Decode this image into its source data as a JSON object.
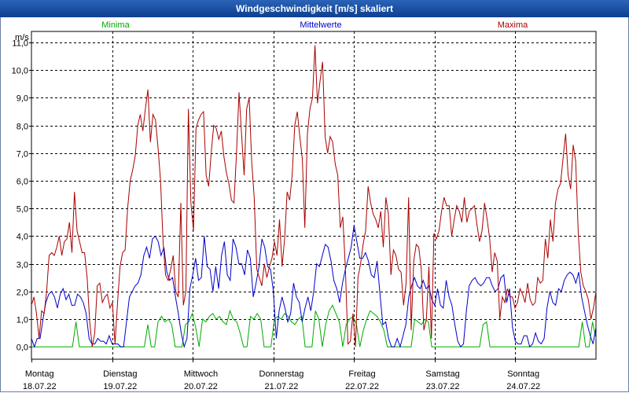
{
  "window": {
    "title": "Windgeschwindigkeit [m/s] skaliert"
  },
  "chart_data": {
    "type": "line",
    "title": "Windgeschwindigkeit [m/s] skaliert",
    "ylabel": "m/s",
    "ylim": [
      -0.45,
      11.4
    ],
    "yticks": [
      "0,0",
      "1,0",
      "2,0",
      "3,0",
      "4,0",
      "5,0",
      "6,0",
      "7,0",
      "8,0",
      "9,0",
      "10,0",
      "11,0"
    ],
    "grid": true,
    "legend_placement": "top",
    "days": [
      {
        "weekday": "Montag",
        "date": "18.07.22"
      },
      {
        "weekday": "Dienstag",
        "date": "19.07.22"
      },
      {
        "weekday": "Mittwoch",
        "date": "20.07.22"
      },
      {
        "weekday": "Donnerstag",
        "date": "21.07.22"
      },
      {
        "weekday": "Freitag",
        "date": "22.07.22"
      },
      {
        "weekday": "Samstag",
        "date": "23.07.22"
      },
      {
        "weekday": "Sonntag",
        "date": "24.07.22"
      }
    ],
    "x_range_days": [
      0,
      7
    ],
    "series": [
      {
        "name": "Minima",
        "color": "#00aa00",
        "values": [
          0,
          0,
          0,
          0,
          0,
          0,
          0,
          0,
          0,
          0,
          0,
          0,
          0,
          0.9,
          0,
          0,
          0,
          0,
          0,
          0,
          0,
          0,
          0,
          0,
          0,
          0,
          0,
          0,
          0,
          0,
          0,
          0,
          0,
          0,
          0.8,
          0,
          0,
          0.9,
          1.1,
          0.9,
          1.0,
          0.8,
          0,
          0,
          0,
          0.8,
          0.9,
          1.2,
          0.7,
          0,
          1.0,
          0.9,
          1.1,
          1.2,
          1.0,
          1.1,
          0.9,
          0.8,
          1.3,
          1.0,
          0.9,
          0.5,
          0,
          0,
          1.1,
          1.0,
          1.2,
          1.0,
          0,
          0,
          0,
          1.0,
          1.1,
          1.0,
          1.2,
          1.1,
          0.9,
          0.8,
          1.0,
          1.1,
          0,
          0,
          0,
          1.3,
          1.0,
          0,
          0.8,
          1.3,
          1.5,
          1.2,
          0.9,
          0,
          0.8,
          1.0,
          1.1,
          0.8,
          0,
          0.6,
          1.0,
          1.3,
          1.2,
          1.1,
          0.9,
          0.6,
          0,
          0,
          0,
          0,
          0,
          0,
          0,
          0,
          1.0,
          0.9,
          0.8,
          1.0,
          0.9,
          0,
          0,
          0,
          0,
          0,
          0,
          0,
          0,
          0,
          0,
          0,
          0,
          0,
          0,
          0,
          0.8,
          0.9,
          0,
          0,
          0,
          0,
          0,
          0,
          0,
          0,
          0,
          0,
          0,
          0,
          0,
          0,
          0,
          0,
          0,
          0,
          0,
          0,
          0,
          0,
          0,
          0,
          0,
          0,
          0,
          0.9,
          0,
          0,
          0.9,
          0.3
        ]
      },
      {
        "name": "Mittelwerte",
        "color": "#0000cc",
        "values": [
          0.3,
          0,
          0.3,
          0.3,
          1.0,
          1.6,
          1.9,
          2.0,
          1.8,
          1.4,
          1.9,
          2.1,
          1.7,
          1.9,
          1.5,
          1.5,
          1.9,
          1.8,
          1.6,
          1.2,
          0.3,
          0.1,
          0.1,
          0.3,
          0.2,
          0.2,
          0.1,
          0.4,
          0.1,
          0.1,
          0.1,
          0,
          0,
          0.9,
          1.8,
          2.0,
          2.2,
          2.3,
          2.6,
          3.3,
          3.6,
          3.2,
          3.9,
          4.0,
          3.8,
          3.3,
          3.6,
          2.7,
          2.4,
          2.5,
          1.8,
          1.2,
          0.5,
          0,
          0.3,
          2.1,
          2.6,
          3.2,
          2.4,
          2.5,
          4.0,
          2.9,
          2.8,
          2.0,
          2.9,
          2.1,
          3.3,
          3.8,
          2.6,
          2.4,
          3.9,
          3.6,
          3.0,
          3.0,
          2.6,
          3.5,
          3.2,
          1.8,
          2.3,
          2.9,
          3.9,
          3.6,
          2.9,
          2.8,
          2.0,
          0.3,
          1.3,
          1.8,
          1.4,
          0.9,
          1.2,
          2.3,
          1.8,
          1.6,
          0.9,
          1.4,
          1.8,
          1.3,
          2.0,
          3.0,
          2.9,
          3.3,
          3.7,
          3.6,
          3.1,
          2.4,
          2.1,
          1.6,
          2.3,
          2.8,
          3.2,
          3.6,
          4.4,
          3.8,
          3.2,
          3.2,
          3.4,
          3.1,
          2.6,
          2.5,
          3.1,
          1.9,
          0.8,
          0.9,
          0.3,
          0,
          0,
          0.3,
          0,
          0.4,
          0.8,
          1.8,
          2.2,
          2.5,
          2.2,
          2.1,
          2.4,
          2.1,
          2.2,
          1.7,
          1.5,
          2.1,
          1.5,
          1.4,
          2.4,
          1.8,
          1.5,
          0.8,
          0.2,
          0,
          0.1,
          1.3,
          2.2,
          2.4,
          2.5,
          2.3,
          2.2,
          2.3,
          2.5,
          2.5,
          2.2,
          2.0,
          2.1,
          2.5,
          2.6,
          1.6,
          2.1,
          0.7,
          0.2,
          0.1,
          0.1,
          0.4,
          0.4,
          0,
          0.1,
          0.5,
          0.2,
          0.1,
          0.3,
          1.4,
          2.0,
          1.6,
          1.5,
          2.1,
          2.0,
          2.4,
          2.6,
          2.7,
          2.6,
          2.3,
          2.7,
          1.8,
          1.3,
          0.8,
          0.4,
          0.1,
          0.7
        ]
      },
      {
        "name": "Maxima",
        "color": "#aa0000",
        "values": [
          1.5,
          1.8,
          1.2,
          0.3,
          1.3,
          1.2,
          2.0,
          3.3,
          3.4,
          3.3,
          3.6,
          4.0,
          3.3,
          3.8,
          3.9,
          4.5,
          3.4,
          5.6,
          4.2,
          3.8,
          3.4,
          3.4,
          2.5,
          0.9,
          0,
          0.5,
          2.2,
          2.3,
          1.6,
          1.8,
          1.9,
          1.4,
          1.6,
          0.1,
          1.6,
          2.9,
          3.4,
          3.5,
          5.0,
          6.0,
          6.4,
          6.9,
          8.0,
          8.4,
          7.8,
          8.6,
          9.3,
          7.4,
          8.4,
          8.2,
          7.2,
          6.0,
          3.8,
          2.6,
          2.4,
          2.8,
          3.3,
          2.0,
          1.8,
          5.2,
          1.5,
          2.0,
          8.6,
          5.2,
          4.2,
          7.9,
          8.2,
          8.4,
          8.5,
          6.2,
          5.8,
          7.0,
          8.0,
          7.9,
          7.5,
          7.8,
          6.9,
          6.3,
          5.9,
          5.3,
          5.2,
          7.0,
          9.2,
          7.7,
          6.2,
          8.6,
          9.0,
          6.7,
          5.4,
          2.8,
          2.5,
          2.2,
          3.0,
          2.5,
          2.9,
          3.2,
          3.8,
          3.3,
          4.6,
          2.9,
          3.9,
          5.6,
          5.3,
          6.2,
          8.0,
          8.5,
          7.6,
          6.8,
          4.3,
          7.7,
          8.6,
          9.0,
          10.9,
          8.8,
          9.6,
          10.3,
          7.6,
          7.0,
          7.6,
          7.4,
          6.6,
          6.2,
          4.3,
          4.7,
          2.9,
          0.1,
          0.2,
          1.2,
          0,
          2.5,
          3.0,
          3.7,
          4.2,
          5.8,
          5.2,
          4.8,
          4.6,
          4.3,
          4.9,
          3.6,
          5.4,
          4.8,
          2.6,
          3.5,
          3.3,
          2.8,
          2.7,
          1.5,
          2.3,
          5.4,
          0.6,
          3.1,
          3.7,
          3.6,
          2.8,
          0.6,
          1.0,
          2.9,
          0.3,
          4.1,
          3.9,
          4.2,
          4.9,
          5.4,
          5.1,
          5.1,
          4.0,
          4.6,
          5.1,
          4.9,
          4.5,
          5.4,
          4.5,
          4.9,
          5.0,
          5.1,
          4.4,
          3.8,
          4.2,
          5.2,
          4.6,
          3.9,
          2.7,
          3.4,
          3.1,
          1.0,
          1.8,
          1.6,
          2.1,
          1.8,
          1.8,
          1.4,
          1.6,
          2.1,
          1.9,
          1.6,
          2.3,
          1.7,
          1.5,
          1.6,
          2.5,
          2.3,
          2.4,
          3.9,
          3.2,
          4.6,
          3.8,
          5.2,
          5.7,
          5.9,
          6.8,
          7.7,
          6.2,
          5.7,
          7.3,
          6.7,
          4.1,
          2.7,
          2.2,
          2.0,
          1.7,
          1.0,
          1.4,
          2.0
        ]
      }
    ]
  }
}
